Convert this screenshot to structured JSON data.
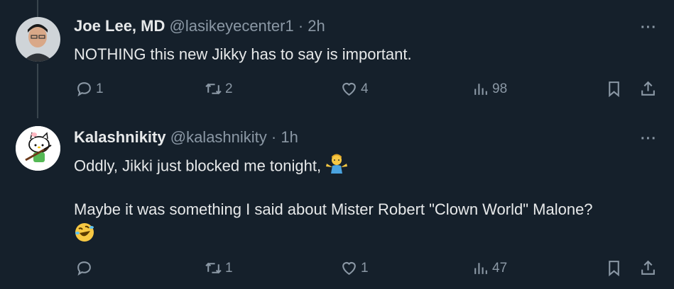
{
  "tweets": [
    {
      "name": "Joe Lee, MD",
      "handle": "@lasikeyecenter1",
      "separator": "·",
      "time": "2h",
      "text_lines": [
        "NOTHING this new Jikky has to say is important."
      ],
      "replies": "1",
      "retweets": "2",
      "likes": "4",
      "views": "98"
    },
    {
      "name": "Kalashnikity",
      "handle": "@kalashnikity",
      "separator": "·",
      "time": "1h",
      "text_lines": [
        "Oddly, Jikki just blocked me tonight,",
        "Maybe it was something I said about Mister Robert \"Clown World\" Malone?"
      ],
      "replies": "",
      "retweets": "1",
      "likes": "1",
      "views": "47"
    }
  ],
  "more_label": "···",
  "colors": {
    "background": "#15202b",
    "text": "#e7e9ea",
    "muted": "#8b98a5"
  }
}
